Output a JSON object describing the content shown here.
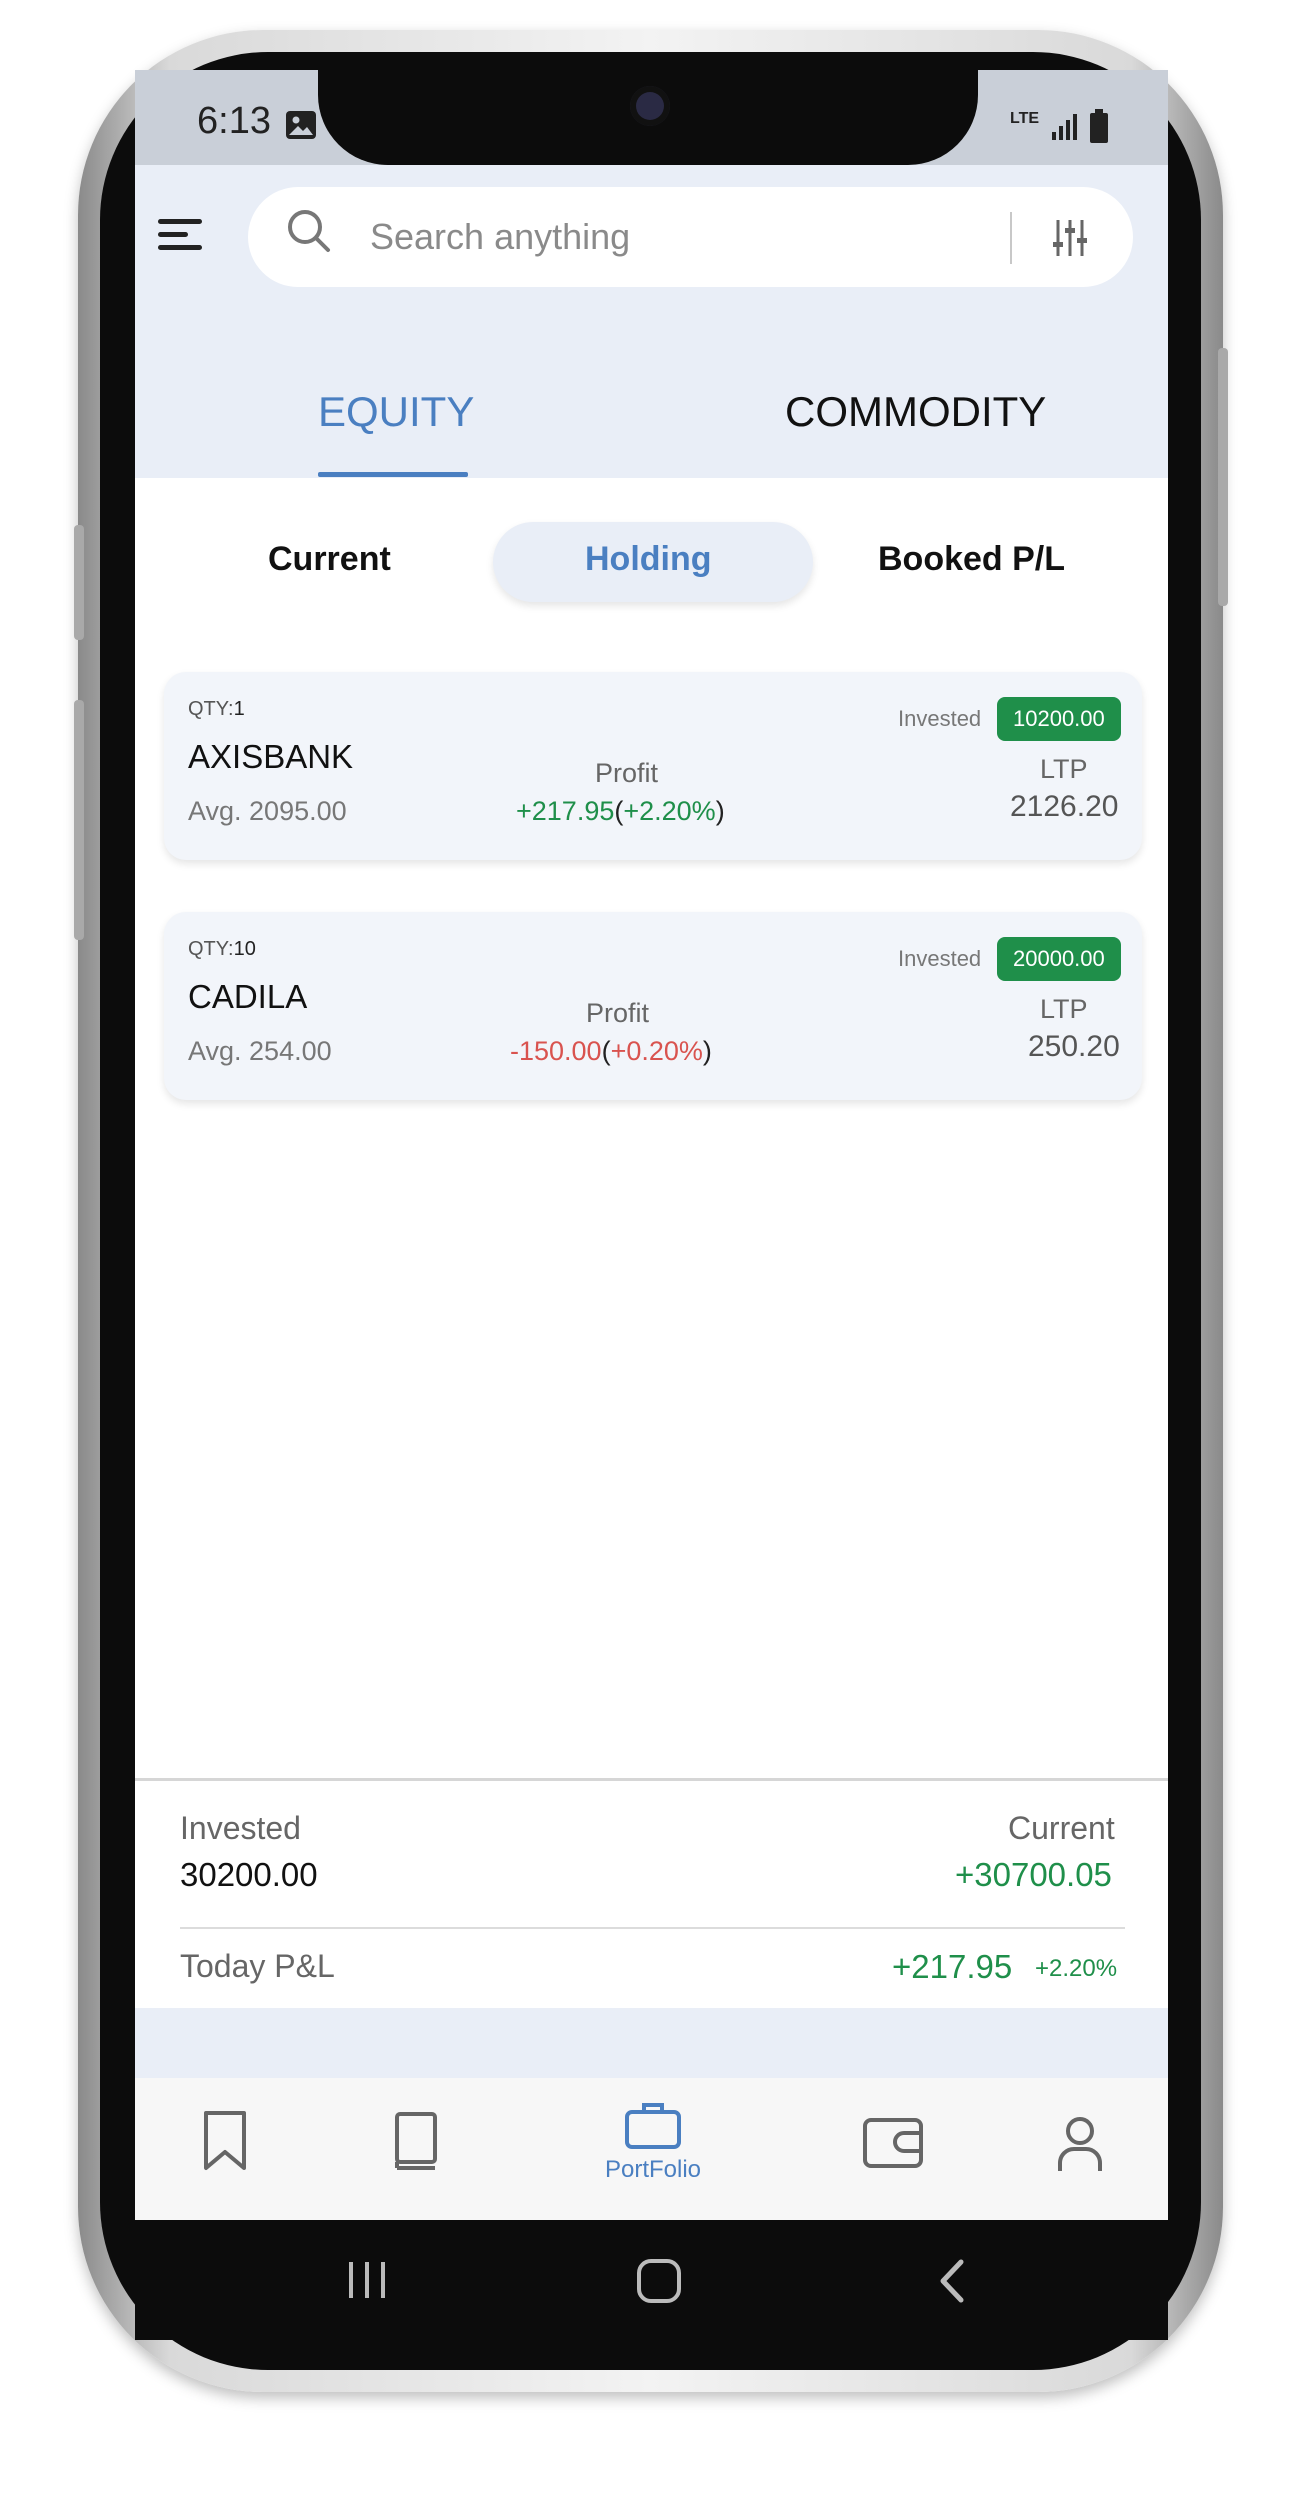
{
  "status_bar": {
    "time": "6:13",
    "network_label": "LTE"
  },
  "header": {
    "search_placeholder": "Search anything"
  },
  "tabs": [
    {
      "label": "EQUITY",
      "active": true
    },
    {
      "label": "COMMODITY",
      "active": false
    }
  ],
  "segments": [
    {
      "label": "Current",
      "active": false
    },
    {
      "label": "Holding",
      "active": true
    },
    {
      "label": "Booked P/L",
      "active": false
    }
  ],
  "holdings": [
    {
      "qty_label": "QTY:",
      "qty": "1",
      "symbol": "AXISBANK",
      "avg": "Avg. 2095.00",
      "profit_label": "Profit",
      "profit_value": "+217.95",
      "profit_pct": "+2.20%",
      "invested_label": "Invested",
      "invested": "10200.00",
      "ltp_label": "LTP",
      "ltp": "2126.20"
    },
    {
      "qty_label": "QTY:",
      "qty": "10",
      "symbol": "CADILA",
      "avg": "Avg. 254.00",
      "profit_label": "Profit",
      "profit_value": "-150.00",
      "profit_pct": "+0.20%",
      "invested_label": "Invested",
      "invested": "20000.00",
      "ltp_label": "LTP",
      "ltp": "250.20"
    }
  ],
  "summary": {
    "invested_label": "Invested",
    "invested_value": "30200.00",
    "current_label": "Current",
    "current_value": "+30700.05",
    "today_pl_label": "Today P&L",
    "today_pl_value": "+217.95",
    "today_pl_pct": "+2.20%"
  },
  "bottom_nav": [
    {
      "icon": "bookmark-icon",
      "label": ""
    },
    {
      "icon": "book-icon",
      "label": ""
    },
    {
      "icon": "briefcase-icon",
      "label": "PortFolio",
      "active": true
    },
    {
      "icon": "wallet-icon",
      "label": ""
    },
    {
      "icon": "user-icon",
      "label": ""
    }
  ],
  "colors": {
    "accent": "#4a7fc1",
    "profit_green": "#1f8f4a",
    "loss_red": "#d9534f",
    "header_bg": "#e9eef7"
  }
}
